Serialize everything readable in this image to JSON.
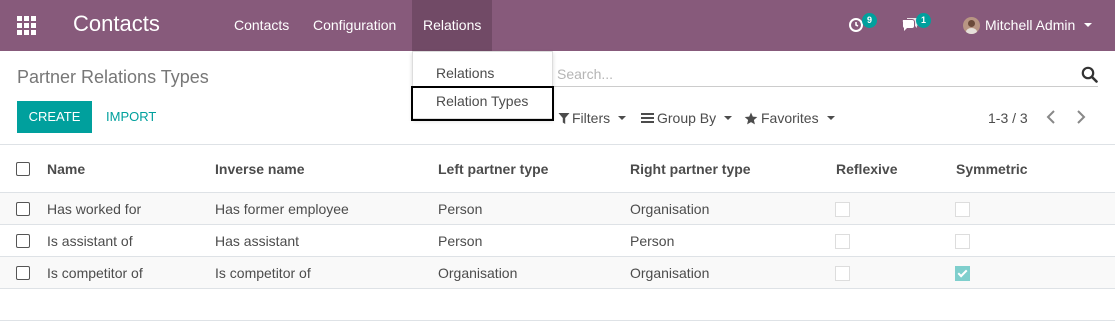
{
  "navbar": {
    "brand": "Contacts",
    "menus": [
      "Contacts",
      "Configuration",
      "Relations"
    ],
    "activity_count": "9",
    "message_count": "1",
    "user_name": "Mitchell Admin"
  },
  "dropdown": {
    "items": [
      "Relations",
      "Relation Types"
    ]
  },
  "control": {
    "title": "Partner Relations Types",
    "create_label": "CREATE",
    "import_label": "IMPORT",
    "search_placeholder": "Search...",
    "filters_label": "Filters",
    "groupby_label": "Group By",
    "favorites_label": "Favorites",
    "pager": "1-3 / 3"
  },
  "table": {
    "columns": [
      "Name",
      "Inverse name",
      "Left partner type",
      "Right partner type",
      "Reflexive",
      "Symmetric"
    ],
    "rows": [
      {
        "name": "Has worked for",
        "inverse": "Has former employee",
        "left": "Person",
        "right": "Organisation",
        "reflexive": false,
        "symmetric": false
      },
      {
        "name": "Is assistant of",
        "inverse": "Has assistant",
        "left": "Person",
        "right": "Person",
        "reflexive": false,
        "symmetric": false
      },
      {
        "name": "Is competitor of",
        "inverse": "Is competitor of",
        "left": "Organisation",
        "right": "Organisation",
        "reflexive": false,
        "symmetric": true
      }
    ]
  },
  "colors": {
    "navbar": "#875a7b",
    "active_menu": "#714a66",
    "primary": "#00a09d"
  },
  "icons": {
    "apps": "apps-grid-icon",
    "activity": "clock-icon",
    "messages": "chat-bubbles-icon",
    "search": "search-icon",
    "filters": "funnel-icon",
    "groupby": "list-icon",
    "favorites": "star-icon",
    "pager_prev": "chevron-left-icon",
    "pager_next": "chevron-right-icon"
  }
}
